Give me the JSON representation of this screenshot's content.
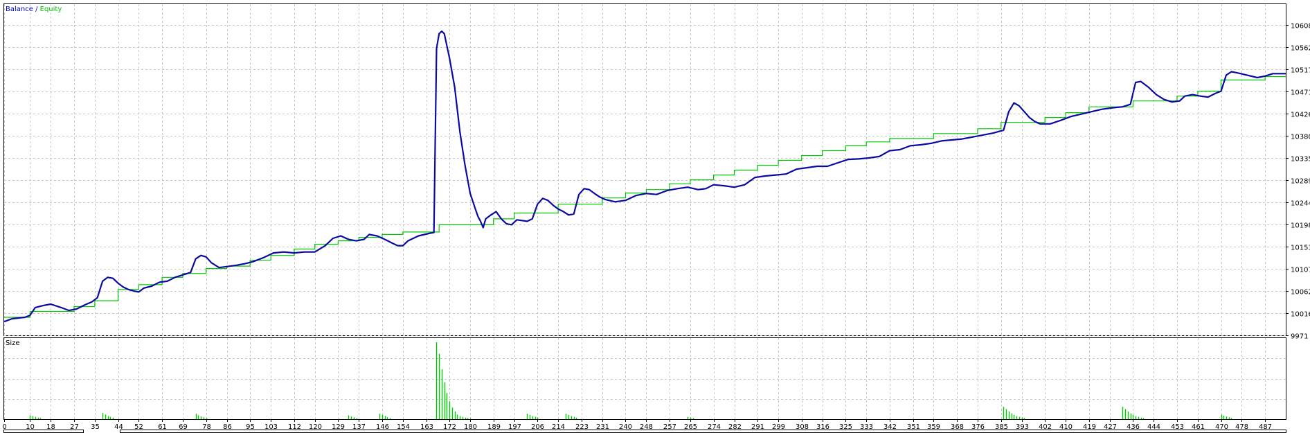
{
  "legend": {
    "balance": "Balance",
    "separator": " / ",
    "equity": "Equity",
    "balance_color": "#0000cc",
    "equity_color": "#00c800"
  },
  "size_panel": {
    "label": "Size",
    "bar_color": "#00c800"
  },
  "chart_data": [
    {
      "type": "line",
      "title": "",
      "series_names_printed": [
        "Balance",
        "Equity"
      ],
      "ylim": [
        9971,
        10630
      ],
      "y_ticks": [
        "10608",
        "10562",
        "10517",
        "10471",
        "10426",
        "10380",
        "10335",
        "10289",
        "10244",
        "10198",
        "10153",
        "10107",
        "10062",
        "10016",
        "9971"
      ],
      "x_ticks": [
        "0",
        "10",
        "18",
        "27",
        "35",
        "44",
        "52",
        "61",
        "69",
        "78",
        "86",
        "95",
        "103",
        "112",
        "120",
        "129",
        "137",
        "146",
        "154",
        "163",
        "172",
        "180",
        "189",
        "197",
        "206",
        "214",
        "223",
        "231",
        "240",
        "248",
        "257",
        "265",
        "274",
        "282",
        "291",
        "299",
        "308",
        "316",
        "325",
        "333",
        "342",
        "351",
        "359",
        "368",
        "376",
        "385",
        "393",
        "402",
        "410",
        "419",
        "427",
        "436",
        "444",
        "453",
        "461",
        "470",
        "478",
        "487"
      ],
      "xlim": [
        0,
        495
      ],
      "grid": true,
      "legend_position": "top-left",
      "balance": [
        [
          0,
          10008
        ],
        [
          10,
          10008
        ],
        [
          10,
          10020
        ],
        [
          27,
          10020
        ],
        [
          27,
          10030
        ],
        [
          35,
          10030
        ],
        [
          35,
          10042
        ],
        [
          44,
          10042
        ],
        [
          44,
          10065
        ],
        [
          52,
          10065
        ],
        [
          52,
          10075
        ],
        [
          61,
          10075
        ],
        [
          61,
          10090
        ],
        [
          69,
          10090
        ],
        [
          69,
          10098
        ],
        [
          78,
          10098
        ],
        [
          78,
          10108
        ],
        [
          86,
          10108
        ],
        [
          86,
          10113
        ],
        [
          95,
          10113
        ],
        [
          95,
          10125
        ],
        [
          103,
          10125
        ],
        [
          103,
          10135
        ],
        [
          112,
          10135
        ],
        [
          112,
          10148
        ],
        [
          120,
          10148
        ],
        [
          120,
          10158
        ],
        [
          129,
          10158
        ],
        [
          129,
          10165
        ],
        [
          137,
          10165
        ],
        [
          137,
          10172
        ],
        [
          146,
          10172
        ],
        [
          146,
          10178
        ],
        [
          154,
          10178
        ],
        [
          154,
          10183
        ],
        [
          168,
          10183
        ],
        [
          168,
          10198
        ],
        [
          189,
          10198
        ],
        [
          189,
          10210
        ],
        [
          197,
          10210
        ],
        [
          197,
          10222
        ],
        [
          214,
          10222
        ],
        [
          214,
          10240
        ],
        [
          231,
          10240
        ],
        [
          231,
          10253
        ],
        [
          240,
          10253
        ],
        [
          240,
          10263
        ],
        [
          248,
          10263
        ],
        [
          248,
          10270
        ],
        [
          257,
          10270
        ],
        [
          257,
          10282
        ],
        [
          265,
          10282
        ],
        [
          265,
          10290
        ],
        [
          274,
          10290
        ],
        [
          274,
          10300
        ],
        [
          282,
          10300
        ],
        [
          282,
          10310
        ],
        [
          291,
          10310
        ],
        [
          291,
          10320
        ],
        [
          299,
          10320
        ],
        [
          299,
          10330
        ],
        [
          308,
          10330
        ],
        [
          308,
          10340
        ],
        [
          316,
          10340
        ],
        [
          316,
          10350
        ],
        [
          325,
          10350
        ],
        [
          325,
          10360
        ],
        [
          333,
          10360
        ],
        [
          333,
          10368
        ],
        [
          342,
          10368
        ],
        [
          342,
          10375
        ],
        [
          359,
          10375
        ],
        [
          359,
          10385
        ],
        [
          376,
          10385
        ],
        [
          376,
          10395
        ],
        [
          385,
          10395
        ],
        [
          385,
          10408
        ],
        [
          402,
          10408
        ],
        [
          402,
          10418
        ],
        [
          410,
          10418
        ],
        [
          410,
          10428
        ],
        [
          419,
          10428
        ],
        [
          419,
          10440
        ],
        [
          436,
          10440
        ],
        [
          436,
          10452
        ],
        [
          453,
          10452
        ],
        [
          453,
          10462
        ],
        [
          461,
          10462
        ],
        [
          461,
          10472
        ],
        [
          470,
          10472
        ],
        [
          470,
          10495
        ],
        [
          487,
          10495
        ],
        [
          487,
          10502
        ],
        [
          495,
          10502
        ]
      ],
      "equity": [
        [
          0,
          9999
        ],
        [
          3,
          10005
        ],
        [
          8,
          10008
        ],
        [
          10,
          10012
        ],
        [
          12,
          10028
        ],
        [
          15,
          10032
        ],
        [
          18,
          10035
        ],
        [
          22,
          10028
        ],
        [
          25,
          10022
        ],
        [
          28,
          10025
        ],
        [
          31,
          10033
        ],
        [
          34,
          10040
        ],
        [
          36,
          10048
        ],
        [
          38,
          10082
        ],
        [
          40,
          10090
        ],
        [
          42,
          10088
        ],
        [
          44,
          10078
        ],
        [
          46,
          10070
        ],
        [
          48,
          10065
        ],
        [
          50,
          10062
        ],
        [
          52,
          10060
        ],
        [
          54,
          10068
        ],
        [
          57,
          10072
        ],
        [
          60,
          10080
        ],
        [
          63,
          10082
        ],
        [
          66,
          10090
        ],
        [
          69,
          10095
        ],
        [
          72,
          10100
        ],
        [
          74,
          10128
        ],
        [
          76,
          10135
        ],
        [
          78,
          10132
        ],
        [
          80,
          10120
        ],
        [
          83,
          10110
        ],
        [
          86,
          10112
        ],
        [
          90,
          10115
        ],
        [
          93,
          10118
        ],
        [
          96,
          10122
        ],
        [
          100,
          10130
        ],
        [
          104,
          10140
        ],
        [
          108,
          10142
        ],
        [
          112,
          10140
        ],
        [
          116,
          10142
        ],
        [
          120,
          10142
        ],
        [
          124,
          10155
        ],
        [
          127,
          10170
        ],
        [
          130,
          10175
        ],
        [
          133,
          10168
        ],
        [
          136,
          10165
        ],
        [
          139,
          10168
        ],
        [
          141,
          10178
        ],
        [
          144,
          10175
        ],
        [
          147,
          10168
        ],
        [
          150,
          10160
        ],
        [
          152,
          10155
        ],
        [
          154,
          10155
        ],
        [
          156,
          10165
        ],
        [
          160,
          10175
        ],
        [
          164,
          10180
        ],
        [
          166,
          10182
        ],
        [
          167,
          10560
        ],
        [
          168,
          10590
        ],
        [
          169,
          10595
        ],
        [
          170,
          10590
        ],
        [
          172,
          10540
        ],
        [
          174,
          10480
        ],
        [
          176,
          10390
        ],
        [
          178,
          10320
        ],
        [
          180,
          10262
        ],
        [
          182,
          10230
        ],
        [
          183,
          10215
        ],
        [
          184,
          10205
        ],
        [
          185,
          10192
        ],
        [
          186,
          10210
        ],
        [
          188,
          10218
        ],
        [
          190,
          10225
        ],
        [
          192,
          10210
        ],
        [
          194,
          10200
        ],
        [
          196,
          10198
        ],
        [
          198,
          10208
        ],
        [
          202,
          10205
        ],
        [
          204,
          10210
        ],
        [
          206,
          10240
        ],
        [
          208,
          10252
        ],
        [
          210,
          10248
        ],
        [
          212,
          10238
        ],
        [
          214,
          10230
        ],
        [
          216,
          10225
        ],
        [
          218,
          10218
        ],
        [
          220,
          10220
        ],
        [
          222,
          10260
        ],
        [
          224,
          10272
        ],
        [
          226,
          10270
        ],
        [
          228,
          10262
        ],
        [
          230,
          10255
        ],
        [
          232,
          10250
        ],
        [
          236,
          10245
        ],
        [
          240,
          10248
        ],
        [
          244,
          10258
        ],
        [
          248,
          10262
        ],
        [
          252,
          10260
        ],
        [
          256,
          10268
        ],
        [
          260,
          10272
        ],
        [
          264,
          10275
        ],
        [
          268,
          10270
        ],
        [
          271,
          10272
        ],
        [
          274,
          10280
        ],
        [
          278,
          10278
        ],
        [
          282,
          10275
        ],
        [
          286,
          10280
        ],
        [
          290,
          10295
        ],
        [
          294,
          10298
        ],
        [
          298,
          10300
        ],
        [
          302,
          10302
        ],
        [
          306,
          10312
        ],
        [
          310,
          10315
        ],
        [
          314,
          10318
        ],
        [
          318,
          10318
        ],
        [
          322,
          10325
        ],
        [
          326,
          10332
        ],
        [
          330,
          10333
        ],
        [
          334,
          10335
        ],
        [
          338,
          10338
        ],
        [
          342,
          10350
        ],
        [
          346,
          10352
        ],
        [
          350,
          10360
        ],
        [
          354,
          10362
        ],
        [
          358,
          10365
        ],
        [
          362,
          10370
        ],
        [
          366,
          10372
        ],
        [
          370,
          10374
        ],
        [
          374,
          10378
        ],
        [
          378,
          10382
        ],
        [
          382,
          10386
        ],
        [
          386,
          10392
        ],
        [
          388,
          10430
        ],
        [
          390,
          10448
        ],
        [
          392,
          10442
        ],
        [
          394,
          10430
        ],
        [
          396,
          10418
        ],
        [
          398,
          10410
        ],
        [
          400,
          10405
        ],
        [
          404,
          10405
        ],
        [
          408,
          10412
        ],
        [
          412,
          10420
        ],
        [
          416,
          10425
        ],
        [
          420,
          10430
        ],
        [
          424,
          10435
        ],
        [
          428,
          10438
        ],
        [
          432,
          10440
        ],
        [
          435,
          10445
        ],
        [
          437,
          10490
        ],
        [
          439,
          10492
        ],
        [
          442,
          10480
        ],
        [
          445,
          10465
        ],
        [
          448,
          10455
        ],
        [
          451,
          10450
        ],
        [
          454,
          10452
        ],
        [
          456,
          10462
        ],
        [
          459,
          10465
        ],
        [
          462,
          10462
        ],
        [
          465,
          10460
        ],
        [
          468,
          10468
        ],
        [
          470,
          10472
        ],
        [
          472,
          10505
        ],
        [
          474,
          10512
        ],
        [
          476,
          10510
        ],
        [
          480,
          10505
        ],
        [
          484,
          10500
        ],
        [
          487,
          10503
        ],
        [
          490,
          10508
        ],
        [
          495,
          10508
        ]
      ]
    },
    {
      "type": "bar",
      "title": "Size",
      "ylim": [
        0,
        10
      ],
      "bars": [
        [
          10,
          0.5
        ],
        [
          11,
          0.4
        ],
        [
          12,
          0.3
        ],
        [
          13,
          0.2
        ],
        [
          14,
          0.15
        ],
        [
          38,
          0.8
        ],
        [
          39,
          0.6
        ],
        [
          40,
          0.4
        ],
        [
          41,
          0.3
        ],
        [
          42,
          0.2
        ],
        [
          74,
          0.7
        ],
        [
          75,
          0.5
        ],
        [
          76,
          0.35
        ],
        [
          77,
          0.25
        ],
        [
          78,
          0.15
        ],
        [
          133,
          0.5
        ],
        [
          134,
          0.35
        ],
        [
          135,
          0.25
        ],
        [
          136,
          0.15
        ],
        [
          145,
          0.7
        ],
        [
          146,
          0.55
        ],
        [
          147,
          0.4
        ],
        [
          148,
          0.25
        ],
        [
          149,
          0.15
        ],
        [
          167,
          10
        ],
        [
          168,
          8.5
        ],
        [
          169,
          6.5
        ],
        [
          170,
          4.8
        ],
        [
          171,
          3.4
        ],
        [
          172,
          2.3
        ],
        [
          173,
          1.5
        ],
        [
          174,
          1.0
        ],
        [
          175,
          0.6
        ],
        [
          176,
          0.4
        ],
        [
          177,
          0.3
        ],
        [
          178,
          0.2
        ],
        [
          179,
          0.15
        ],
        [
          180,
          0.1
        ],
        [
          202,
          0.7
        ],
        [
          203,
          0.55
        ],
        [
          204,
          0.4
        ],
        [
          205,
          0.3
        ],
        [
          206,
          0.2
        ],
        [
          217,
          0.7
        ],
        [
          218,
          0.55
        ],
        [
          219,
          0.4
        ],
        [
          220,
          0.3
        ],
        [
          221,
          0.2
        ],
        [
          264,
          0.3
        ],
        [
          265,
          0.2
        ],
        [
          266,
          0.15
        ],
        [
          386,
          1.6
        ],
        [
          387,
          1.3
        ],
        [
          388,
          1.0
        ],
        [
          389,
          0.75
        ],
        [
          390,
          0.55
        ],
        [
          391,
          0.4
        ],
        [
          392,
          0.3
        ],
        [
          393,
          0.2
        ],
        [
          394,
          0.15
        ],
        [
          432,
          1.6
        ],
        [
          433,
          1.3
        ],
        [
          434,
          1.0
        ],
        [
          435,
          0.75
        ],
        [
          436,
          0.55
        ],
        [
          437,
          0.4
        ],
        [
          438,
          0.3
        ],
        [
          439,
          0.2
        ],
        [
          440,
          0.15
        ],
        [
          470,
          0.6
        ],
        [
          471,
          0.45
        ],
        [
          472,
          0.35
        ],
        [
          473,
          0.25
        ],
        [
          474,
          0.15
        ]
      ]
    }
  ]
}
